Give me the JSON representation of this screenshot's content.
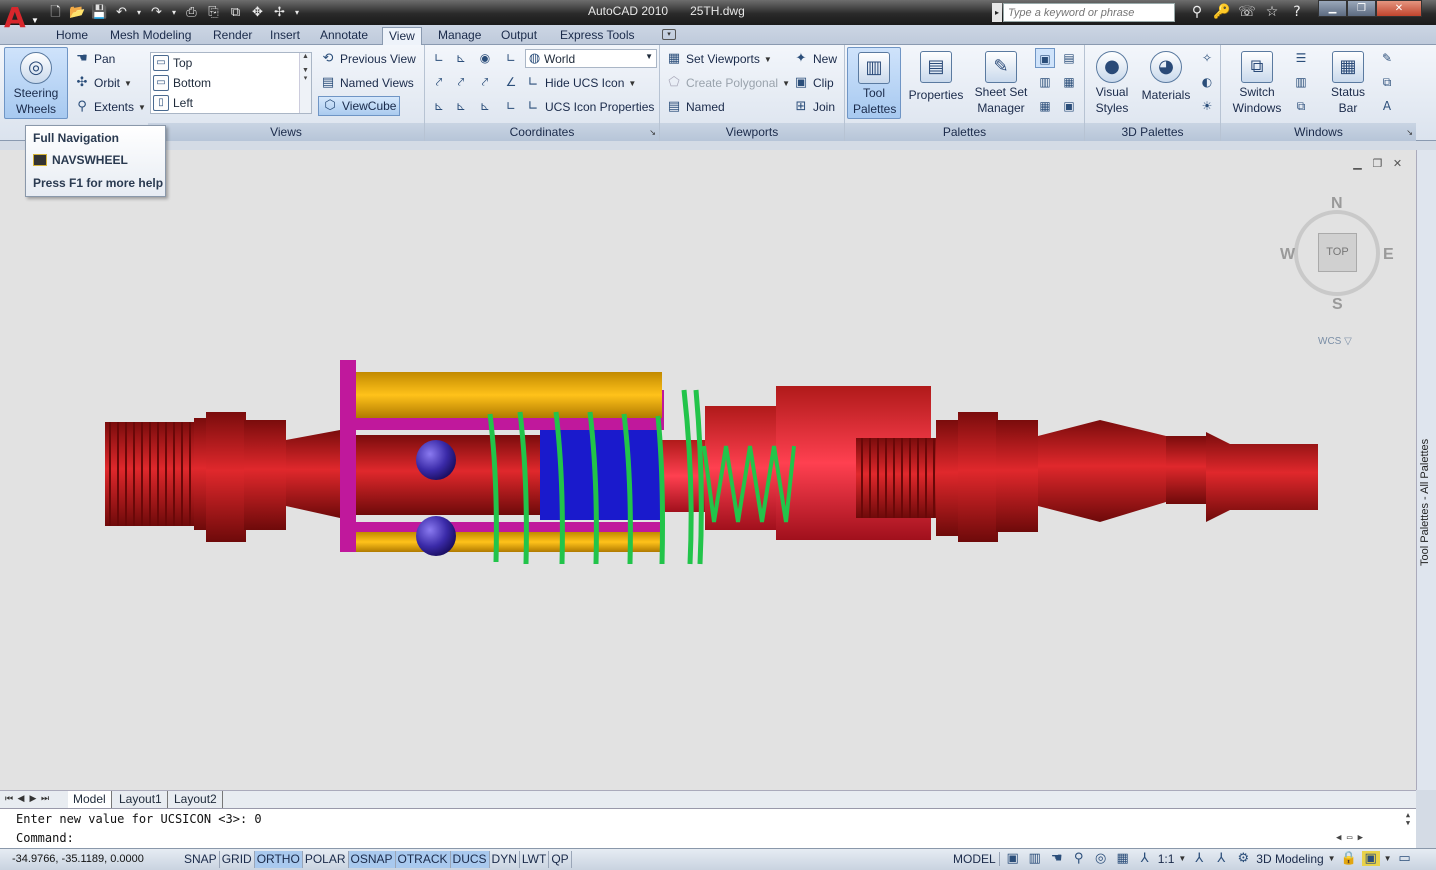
{
  "window": {
    "app_name": "AutoCAD 2010",
    "file_name": "25TH.dwg"
  },
  "search": {
    "placeholder": "Type a keyword or phrase"
  },
  "ribbon_tabs": [
    "Home",
    "Mesh Modeling",
    "Render",
    "Insert",
    "Annotate",
    "View",
    "Manage",
    "Output",
    "Express Tools"
  ],
  "active_tab": "View",
  "navigate": {
    "steering_wheels": "Steering Wheels",
    "pan": "Pan",
    "orbit": "Orbit",
    "extents": "Extents"
  },
  "views": {
    "title": "Views",
    "list": [
      "Top",
      "Bottom",
      "Left"
    ],
    "previous_view": "Previous View",
    "named_views": "Named Views",
    "viewcube": "ViewCube"
  },
  "coordinates": {
    "title": "Coordinates",
    "world": "World",
    "hide_ucs_icon": "Hide UCS Icon",
    "ucs_icon_properties": "UCS Icon Properties"
  },
  "viewports": {
    "title": "Viewports",
    "set_viewports": "Set Viewports",
    "create_polygonal": "Create Polygonal",
    "named": "Named",
    "new": "New",
    "clip": "Clip",
    "join": "Join"
  },
  "palettes": {
    "title": "Palettes",
    "tool_palettes": "Tool Palettes",
    "properties": "Properties",
    "sheet_set_manager": "Sheet Set Manager"
  },
  "palettes_3d": {
    "title": "3D Palettes",
    "visual_styles": "Visual Styles",
    "materials": "Materials"
  },
  "windows": {
    "title": "Windows",
    "switch_windows": "Switch Windows",
    "status_bar": "Status Bar"
  },
  "tooltip": {
    "heading": "Full Navigation",
    "command": "NAVSWHEEL",
    "help": "Press F1 for more help"
  },
  "viewcube": {
    "face": "TOP",
    "north": "N",
    "south": "S",
    "east": "E",
    "west": "W",
    "wcs": "WCS"
  },
  "side_palette": "Tool Palettes - All Palettes",
  "layout_tabs": [
    "Model",
    "Layout1",
    "Layout2"
  ],
  "command_line": {
    "history": "Enter new value for UCSICON <3>: 0",
    "prompt": "Command:"
  },
  "status_bar": {
    "coordinates": "-34.9766, -35.1189, 0.0000",
    "toggles": [
      {
        "label": "SNAP",
        "on": false
      },
      {
        "label": "GRID",
        "on": false
      },
      {
        "label": "ORTHO",
        "on": true
      },
      {
        "label": "POLAR",
        "on": false
      },
      {
        "label": "OSNAP",
        "on": true
      },
      {
        "label": "OTRACK",
        "on": true
      },
      {
        "label": "DUCS",
        "on": true
      },
      {
        "label": "DYN",
        "on": false
      },
      {
        "label": "LWT",
        "on": false
      },
      {
        "label": "QP",
        "on": false
      }
    ],
    "model": "MODEL",
    "scale": "1:1",
    "workspace": "3D Modeling"
  },
  "colors": {
    "body_red": "#b01a1a",
    "sleeve_yellow": "#e6a600",
    "collar_magenta": "#c0189c",
    "spring_green": "#26c24a",
    "ball_blue": "#3a2aa8",
    "core_blue": "#1a1acc",
    "viewport_bg": "#e2e2e2"
  }
}
